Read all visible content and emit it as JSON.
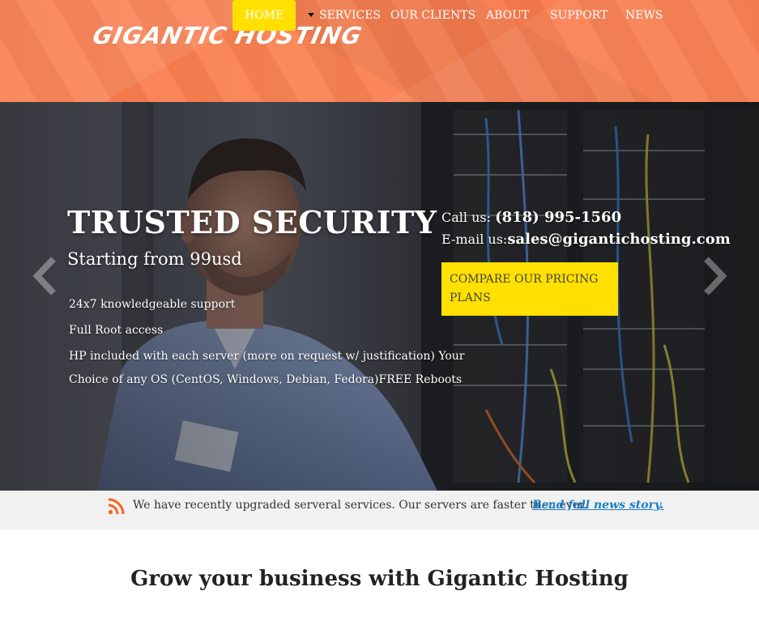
{
  "brand": {
    "logo_text": "GIGANTIC HOSTING"
  },
  "nav": {
    "items": [
      {
        "label": "HOME",
        "active": true
      },
      {
        "label": "SERVICES",
        "has_dropdown": true
      },
      {
        "label": "OUR CLIENTS"
      },
      {
        "label": "ABOUT"
      },
      {
        "label": "SUPPORT"
      },
      {
        "label": "NEWS"
      }
    ]
  },
  "hero": {
    "title": "TRUSTED SECURITY",
    "subtitle": "Starting from 99usd",
    "features": [
      "24x7 knowledgeable support",
      "Full Root access",
      "HP included with each server (more on request w/ justification) Your",
      "Choice of any OS (CentOS, Windows, Debian, Fedora)FREE Reboots"
    ],
    "call_label": "Call us: ",
    "phone": "(818) 995-1560",
    "email_label": "E-mail us:",
    "email": "sales@gigantichosting.com",
    "cta_label": "COMPARE OUR PRICING PLANS",
    "prev_icon": "chevron-left-icon",
    "next_icon": "chevron-right-icon"
  },
  "news": {
    "icon": "rss-icon",
    "text": "We have recently upgraded serveral services. Our servers are faster then ever.",
    "link_label": "Read full news story."
  },
  "section": {
    "heading_prefix": "Grow your business with ",
    "heading_brand": "Gigantic Hosting"
  },
  "colors": {
    "header_orange": "#f97a4b",
    "accent_yellow": "#ffe000",
    "link_blue": "#1a7fc8",
    "rss_orange": "#f26522"
  }
}
